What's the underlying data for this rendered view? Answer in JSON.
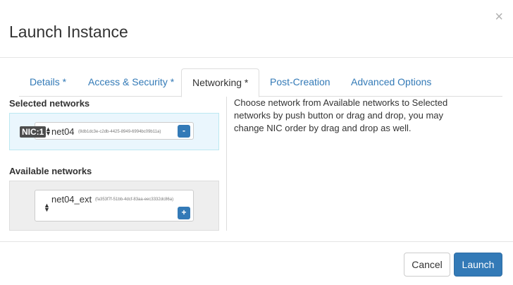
{
  "modal": {
    "title": "Launch Instance",
    "close_symbol": "×"
  },
  "tabs": [
    {
      "label": "Details *",
      "active": false
    },
    {
      "label": "Access & Security *",
      "active": false
    },
    {
      "label": "Networking *",
      "active": true
    },
    {
      "label": "Post-Creation",
      "active": false
    },
    {
      "label": "Advanced Options",
      "active": false
    }
  ],
  "networking": {
    "selected_label": "Selected networks",
    "available_label": "Available networks",
    "selected": [
      {
        "nic": "NIC:1",
        "name": "net04",
        "id": "(8db1dc3e-c2db-4425-8949-6994bc09b11a)",
        "action": "-"
      }
    ],
    "available": [
      {
        "name": "net04_ext",
        "id": "(fa353f7f-51bb-4dcf-83aa-eec3332dc86a)",
        "action": "+"
      }
    ],
    "help": "Choose network from Available networks to Selected networks by push button or drag and drop, you may change NIC order by drag and drop as well."
  },
  "footer": {
    "cancel_label": "Cancel",
    "launch_label": "Launch"
  },
  "colors": {
    "primary": "#337ab7",
    "selected_bg": "#eaf6fd",
    "available_bg": "#eeeeee",
    "badge_bg": "#4d4d4d"
  },
  "icons": {
    "sort": "sort-icon",
    "close": "close-icon"
  }
}
